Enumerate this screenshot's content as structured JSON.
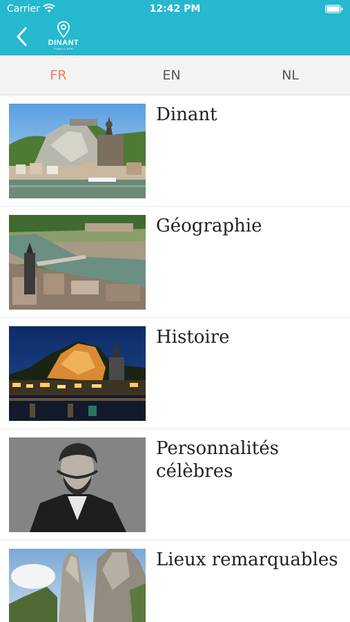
{
  "status_bar": {
    "carrier": "Carrier",
    "time": "12:42 PM",
    "wifi_icon": "wifi-icon",
    "battery_icon": "battery-icon"
  },
  "nav_bar": {
    "back_icon": "chevron-left-icon",
    "logo_name": "DINANT",
    "logo_subtitle": "PUBLIC APP",
    "background_color": "#26b8cf"
  },
  "language_tabs": [
    {
      "label": "FR",
      "active": true
    },
    {
      "label": "EN",
      "active": false
    },
    {
      "label": "NL",
      "active": false
    }
  ],
  "accent_color": "#f27a5c",
  "items": [
    {
      "title": "Dinant",
      "image": "citadel-and-collegiate-church-photo"
    },
    {
      "title": "Géographie",
      "image": "aerial-city-river-photo"
    },
    {
      "title": "Histoire",
      "image": "night-city-illuminated-photo"
    },
    {
      "title": "Personnalités célèbres",
      "image": "portrait-man-photo"
    },
    {
      "title": "Lieux remarquables",
      "image": "rock-cliffs-photo"
    }
  ]
}
